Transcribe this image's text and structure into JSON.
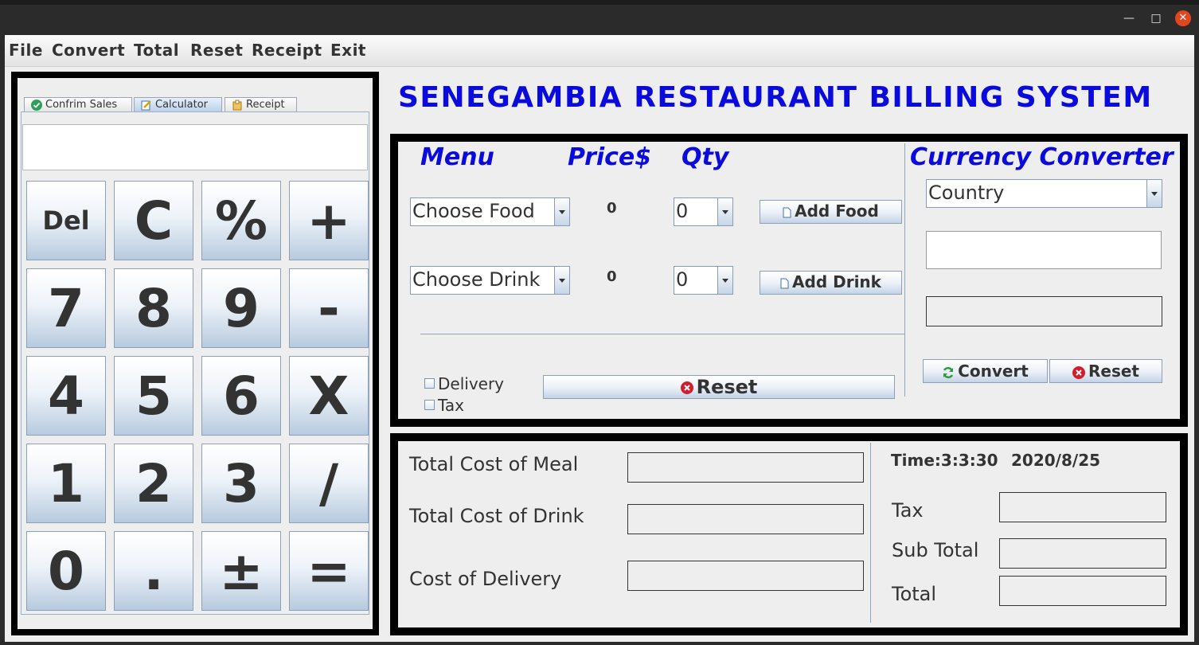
{
  "window": {
    "controls": {
      "minimize": "—",
      "maximize": "□",
      "close": "✕"
    }
  },
  "menubar": {
    "items": [
      "File",
      "Convert",
      "Total",
      "Reset",
      "Receipt",
      "Exit"
    ]
  },
  "tabs": [
    {
      "label": "Confrim Sales",
      "icon": "check-circle-icon",
      "active": false
    },
    {
      "label": "Calculator",
      "icon": "pencil-note-icon",
      "active": true
    },
    {
      "label": "Receipt",
      "icon": "receipt-icon",
      "active": false
    }
  ],
  "calculator": {
    "display": "",
    "keys": [
      [
        "Del",
        "C",
        "%",
        "+"
      ],
      [
        "7",
        "8",
        "9",
        "-"
      ],
      [
        "4",
        "5",
        "6",
        "X"
      ],
      [
        "1",
        "2",
        "3",
        "/"
      ],
      [
        "0",
        ".",
        "±",
        "="
      ]
    ]
  },
  "title": "SENEGAMBIA RESTAURANT BILLING SYSTEM",
  "order": {
    "headers": {
      "menu": "Menu",
      "price": "Price$",
      "qty": "Qty",
      "converter": "Currency Converter"
    },
    "food": {
      "select": "Choose Food",
      "price": "0",
      "qty": "0",
      "button": "Add Food"
    },
    "drink": {
      "select": "Choose Drink",
      "price": "0",
      "qty": "0",
      "button": "Add Drink"
    },
    "delivery_label": "Delivery",
    "tax_label": "Tax",
    "reset_label": "Reset"
  },
  "converter": {
    "country": "Country",
    "input": "",
    "result": "",
    "convert_label": "Convert",
    "reset_label": "Reset"
  },
  "totals": {
    "meal_label": "Total Cost of Meal",
    "drink_label": "Total Cost of Drink",
    "delivery_label": "Cost of Delivery",
    "time": "Time:3:3:30",
    "date": "2020/8/25",
    "tax_label": "Tax",
    "subtotal_label": "Sub Total",
    "total_label": "Total"
  },
  "colors": {
    "title_blue": "#0a0adc",
    "frame": "#000000",
    "panel": "#eeeeee"
  }
}
